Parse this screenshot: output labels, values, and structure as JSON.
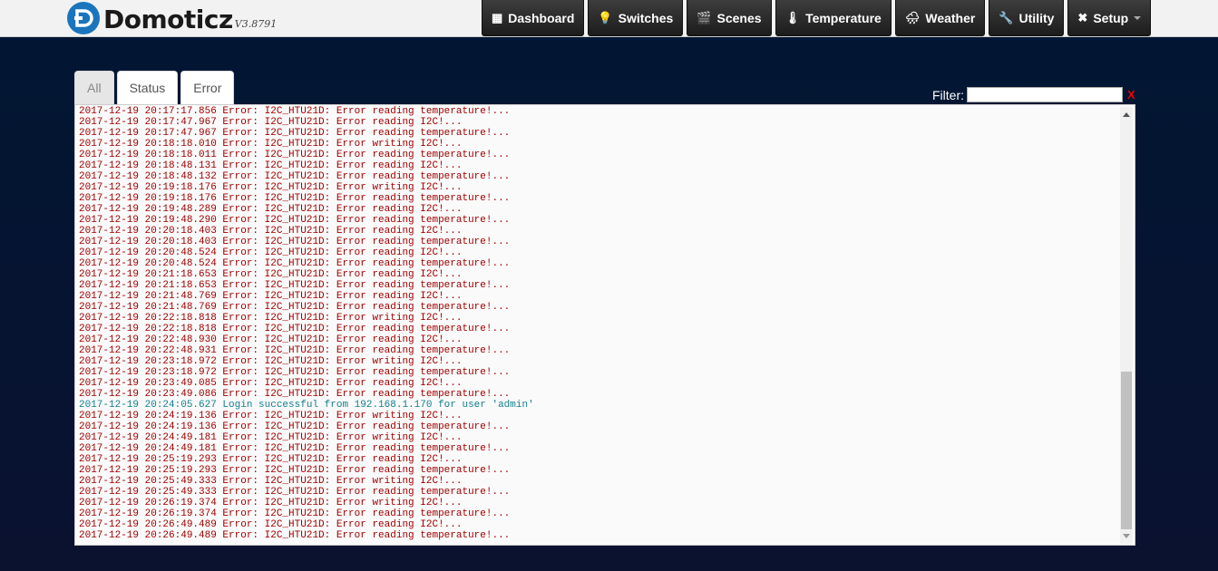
{
  "app": {
    "name": "Domoticz",
    "version": "V3.8791"
  },
  "nav": [
    {
      "label": "Dashboard",
      "icon": "dashboard-icon",
      "glyph": "▦"
    },
    {
      "label": "Switches",
      "icon": "lightbulb-icon",
      "glyph": "💡"
    },
    {
      "label": "Scenes",
      "icon": "clapperboard-icon",
      "glyph": "🎬"
    },
    {
      "label": "Temperature",
      "icon": "thermometer-icon",
      "glyph": "🌡"
    },
    {
      "label": "Weather",
      "icon": "cloud-rain-icon",
      "glyph": "🌧"
    },
    {
      "label": "Utility",
      "icon": "utility-icon",
      "glyph": "🔧"
    },
    {
      "label": "Setup",
      "icon": "tools-icon",
      "glyph": "✖"
    }
  ],
  "tabs": [
    "All",
    "Status",
    "Error"
  ],
  "active_tab": "All",
  "filter": {
    "label": "Filter:",
    "value": "",
    "clear": "X"
  },
  "colors": {
    "error_text": "#a00000",
    "status_text": "#107f8c",
    "logo_blue": "#1b75bc"
  },
  "log": [
    {
      "text": "2017-12-19 20:17:17.856 Error: I2C_HTU21D: Error reading temperature!...",
      "level": "error"
    },
    {
      "text": "2017-12-19 20:17:47.967 Error: I2C_HTU21D: Error reading I2C!...",
      "level": "error"
    },
    {
      "text": "2017-12-19 20:17:47.967 Error: I2C_HTU21D: Error reading temperature!...",
      "level": "error"
    },
    {
      "text": "2017-12-19 20:18:18.010 Error: I2C_HTU21D: Error writing I2C!...",
      "level": "error"
    },
    {
      "text": "2017-12-19 20:18:18.011 Error: I2C_HTU21D: Error reading temperature!...",
      "level": "error"
    },
    {
      "text": "2017-12-19 20:18:48.131 Error: I2C_HTU21D: Error reading I2C!...",
      "level": "error"
    },
    {
      "text": "2017-12-19 20:18:48.132 Error: I2C_HTU21D: Error reading temperature!...",
      "level": "error"
    },
    {
      "text": "2017-12-19 20:19:18.176 Error: I2C_HTU21D: Error writing I2C!...",
      "level": "error"
    },
    {
      "text": "2017-12-19 20:19:18.176 Error: I2C_HTU21D: Error reading temperature!...",
      "level": "error"
    },
    {
      "text": "2017-12-19 20:19:48.289 Error: I2C_HTU21D: Error reading I2C!...",
      "level": "error"
    },
    {
      "text": "2017-12-19 20:19:48.290 Error: I2C_HTU21D: Error reading temperature!...",
      "level": "error"
    },
    {
      "text": "2017-12-19 20:20:18.403 Error: I2C_HTU21D: Error reading I2C!...",
      "level": "error"
    },
    {
      "text": "2017-12-19 20:20:18.403 Error: I2C_HTU21D: Error reading temperature!...",
      "level": "error"
    },
    {
      "text": "2017-12-19 20:20:48.524 Error: I2C_HTU21D: Error reading I2C!...",
      "level": "error"
    },
    {
      "text": "2017-12-19 20:20:48.524 Error: I2C_HTU21D: Error reading temperature!...",
      "level": "error"
    },
    {
      "text": "2017-12-19 20:21:18.653 Error: I2C_HTU21D: Error reading I2C!...",
      "level": "error"
    },
    {
      "text": "2017-12-19 20:21:18.653 Error: I2C_HTU21D: Error reading temperature!...",
      "level": "error"
    },
    {
      "text": "2017-12-19 20:21:48.769 Error: I2C_HTU21D: Error reading I2C!...",
      "level": "error"
    },
    {
      "text": "2017-12-19 20:21:48.769 Error: I2C_HTU21D: Error reading temperature!...",
      "level": "error"
    },
    {
      "text": "2017-12-19 20:22:18.818 Error: I2C_HTU21D: Error writing I2C!...",
      "level": "error"
    },
    {
      "text": "2017-12-19 20:22:18.818 Error: I2C_HTU21D: Error reading temperature!...",
      "level": "error"
    },
    {
      "text": "2017-12-19 20:22:48.930 Error: I2C_HTU21D: Error reading I2C!...",
      "level": "error"
    },
    {
      "text": "2017-12-19 20:22:48.931 Error: I2C_HTU21D: Error reading temperature!...",
      "level": "error"
    },
    {
      "text": "2017-12-19 20:23:18.972 Error: I2C_HTU21D: Error writing I2C!...",
      "level": "error"
    },
    {
      "text": "2017-12-19 20:23:18.972 Error: I2C_HTU21D: Error reading temperature!...",
      "level": "error"
    },
    {
      "text": "2017-12-19 20:23:49.085 Error: I2C_HTU21D: Error reading I2C!...",
      "level": "error"
    },
    {
      "text": "2017-12-19 20:23:49.086 Error: I2C_HTU21D: Error reading temperature!...",
      "level": "error"
    },
    {
      "text": "2017-12-19 20:24:05.627 Login successful from 192.168.1.170 for user 'admin'",
      "level": "status"
    },
    {
      "text": "2017-12-19 20:24:19.136 Error: I2C_HTU21D: Error writing I2C!...",
      "level": "error"
    },
    {
      "text": "2017-12-19 20:24:19.136 Error: I2C_HTU21D: Error reading temperature!...",
      "level": "error"
    },
    {
      "text": "2017-12-19 20:24:49.181 Error: I2C_HTU21D: Error writing I2C!...",
      "level": "error"
    },
    {
      "text": "2017-12-19 20:24:49.181 Error: I2C_HTU21D: Error reading temperature!...",
      "level": "error"
    },
    {
      "text": "2017-12-19 20:25:19.293 Error: I2C_HTU21D: Error reading I2C!...",
      "level": "error"
    },
    {
      "text": "2017-12-19 20:25:19.293 Error: I2C_HTU21D: Error reading temperature!...",
      "level": "error"
    },
    {
      "text": "2017-12-19 20:25:49.333 Error: I2C_HTU21D: Error writing I2C!...",
      "level": "error"
    },
    {
      "text": "2017-12-19 20:25:49.333 Error: I2C_HTU21D: Error reading temperature!...",
      "level": "error"
    },
    {
      "text": "2017-12-19 20:26:19.374 Error: I2C_HTU21D: Error writing I2C!...",
      "level": "error"
    },
    {
      "text": "2017-12-19 20:26:19.374 Error: I2C_HTU21D: Error reading temperature!...",
      "level": "error"
    },
    {
      "text": "2017-12-19 20:26:49.489 Error: I2C_HTU21D: Error reading I2C!...",
      "level": "error"
    },
    {
      "text": "2017-12-19 20:26:49.489 Error: I2C_HTU21D: Error reading temperature!...",
      "level": "error"
    }
  ]
}
